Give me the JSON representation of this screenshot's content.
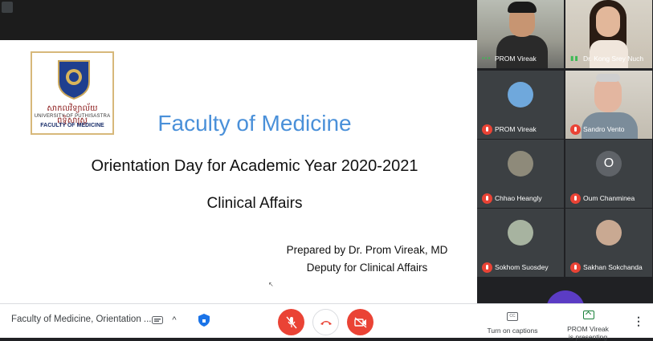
{
  "slide": {
    "logo": {
      "khmer_text": "សាកលវិទ្យាល័យ ពុទ្ធិសាស្ត្រ",
      "university": "UNIVERSITY OF PUTHISASTRA",
      "faculty": "FACULTY OF MEDICINE"
    },
    "title": "Faculty of Medicine",
    "subtitle": "Orientation Day for Academic Year 2020-2021",
    "section": "Clinical Affairs",
    "prepared_by": "Prepared by Dr. Prom Vireak, MD",
    "role": "Deputy for Clinical Affairs",
    "title_color": "#4a90d9"
  },
  "participants": [
    {
      "name": "PROM Vireak",
      "type": "video",
      "status": "speaking"
    },
    {
      "name": "Dr. Kong Srey Nuch",
      "type": "video",
      "status": "speaking"
    },
    {
      "name": "PROM Vireak",
      "type": "avatar",
      "status": "muted"
    },
    {
      "name": "Sandro Vento",
      "type": "video",
      "status": "muted"
    },
    {
      "name": "Chhao Heangly",
      "type": "avatar",
      "status": "muted"
    },
    {
      "name": "Oum Chanminea",
      "type": "initial",
      "initial": "O",
      "status": "muted"
    },
    {
      "name": "Sokhom Suosdey",
      "type": "avatar",
      "status": "muted"
    },
    {
      "name": "Sakhan Sokchanda",
      "type": "avatar",
      "status": "muted"
    }
  ],
  "bottom_bar": {
    "meeting_title": "Faculty of Medicine, Orientation ...",
    "captions_label": "Turn on captions",
    "presenting_line1": "PROM Vireak",
    "presenting_line2": "is presenting",
    "more_label": "⋮"
  },
  "colors": {
    "muted_red": "#ea4335",
    "tile_bg": "#3c4043",
    "speaking_green": "#3cba54"
  }
}
